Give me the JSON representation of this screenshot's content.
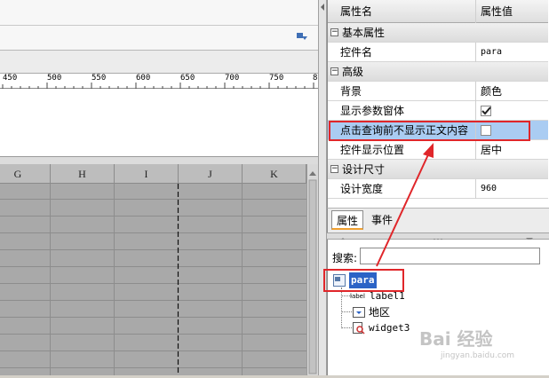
{
  "toolbar": {
    "dropdown_icon": "dropdown-menu-icon"
  },
  "ruler": {
    "ticks": [
      "450",
      "500",
      "550",
      "600",
      "650",
      "700",
      "750",
      "8"
    ]
  },
  "grid": {
    "columns": [
      "G",
      "H",
      "I",
      "J",
      "K"
    ]
  },
  "properties": {
    "header": {
      "name": "属性名",
      "value": "属性值"
    },
    "categories": {
      "basic": "基本属性",
      "advanced": "高级",
      "design": "设计尺寸"
    },
    "rows": {
      "widget_name": {
        "name": "控件名",
        "value": "para"
      },
      "background": {
        "name": "背景",
        "value": "颜色"
      },
      "show_param_window": {
        "name": "显示参数窗体",
        "checked": true
      },
      "hide_body_before_query": {
        "name": "点击查询前不显示正文内容",
        "checked": false
      },
      "widget_position": {
        "name": "控件显示位置",
        "value": "居中"
      },
      "design_width": {
        "name": "设计宽度",
        "value": "960"
      }
    }
  },
  "tabs": {
    "props": "属性",
    "events": "事件"
  },
  "tree": {
    "search_label": "搜索:",
    "search_value": "",
    "nodes": {
      "root": "para",
      "label": "label1",
      "area": "地区",
      "widget": "widget3"
    },
    "label_icon_text": "label"
  },
  "watermark": {
    "text": "Bai 经验",
    "sub": "jingyan.baidu.com"
  },
  "colors": {
    "highlight": "#e0262a",
    "selection": "#aaccf2",
    "tab_accent": "#f0a030"
  }
}
